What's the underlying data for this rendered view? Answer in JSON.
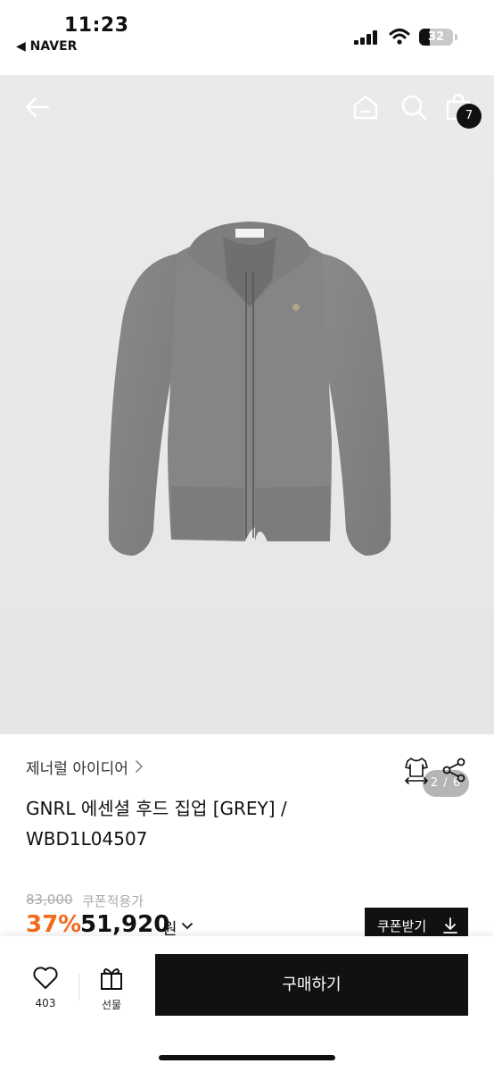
{
  "status_bar": {
    "time": "11:23",
    "back_app": "◀ NAVER",
    "battery": "32"
  },
  "header": {
    "cart_count": "7"
  },
  "gallery": {
    "pager": "2 / 6"
  },
  "product": {
    "brand": "제너럴 아이디어",
    "title": "GNRL 에센셜 후드 집업 [GREY] / WBD1L04507",
    "original_price": "83,000",
    "coupon_note": "쿠폰적용가",
    "discount": "37%",
    "price": "51,920",
    "currency": "원",
    "coupon_button": "쿠폰받기"
  },
  "bottom_bar": {
    "like_count": "403",
    "gift_label": "선물",
    "buy_label": "구매하기"
  },
  "colors": {
    "accent": "#f26b1d",
    "primary_button": "#111111",
    "image_background": "#e8e8e8"
  },
  "icons": [
    "back-arrow-icon",
    "home-icon",
    "search-icon",
    "shopping-bag-icon",
    "chevron-right-icon",
    "fit-size-icon",
    "share-icon",
    "chevron-down-icon",
    "download-icon",
    "heart-icon",
    "gift-icon"
  ]
}
